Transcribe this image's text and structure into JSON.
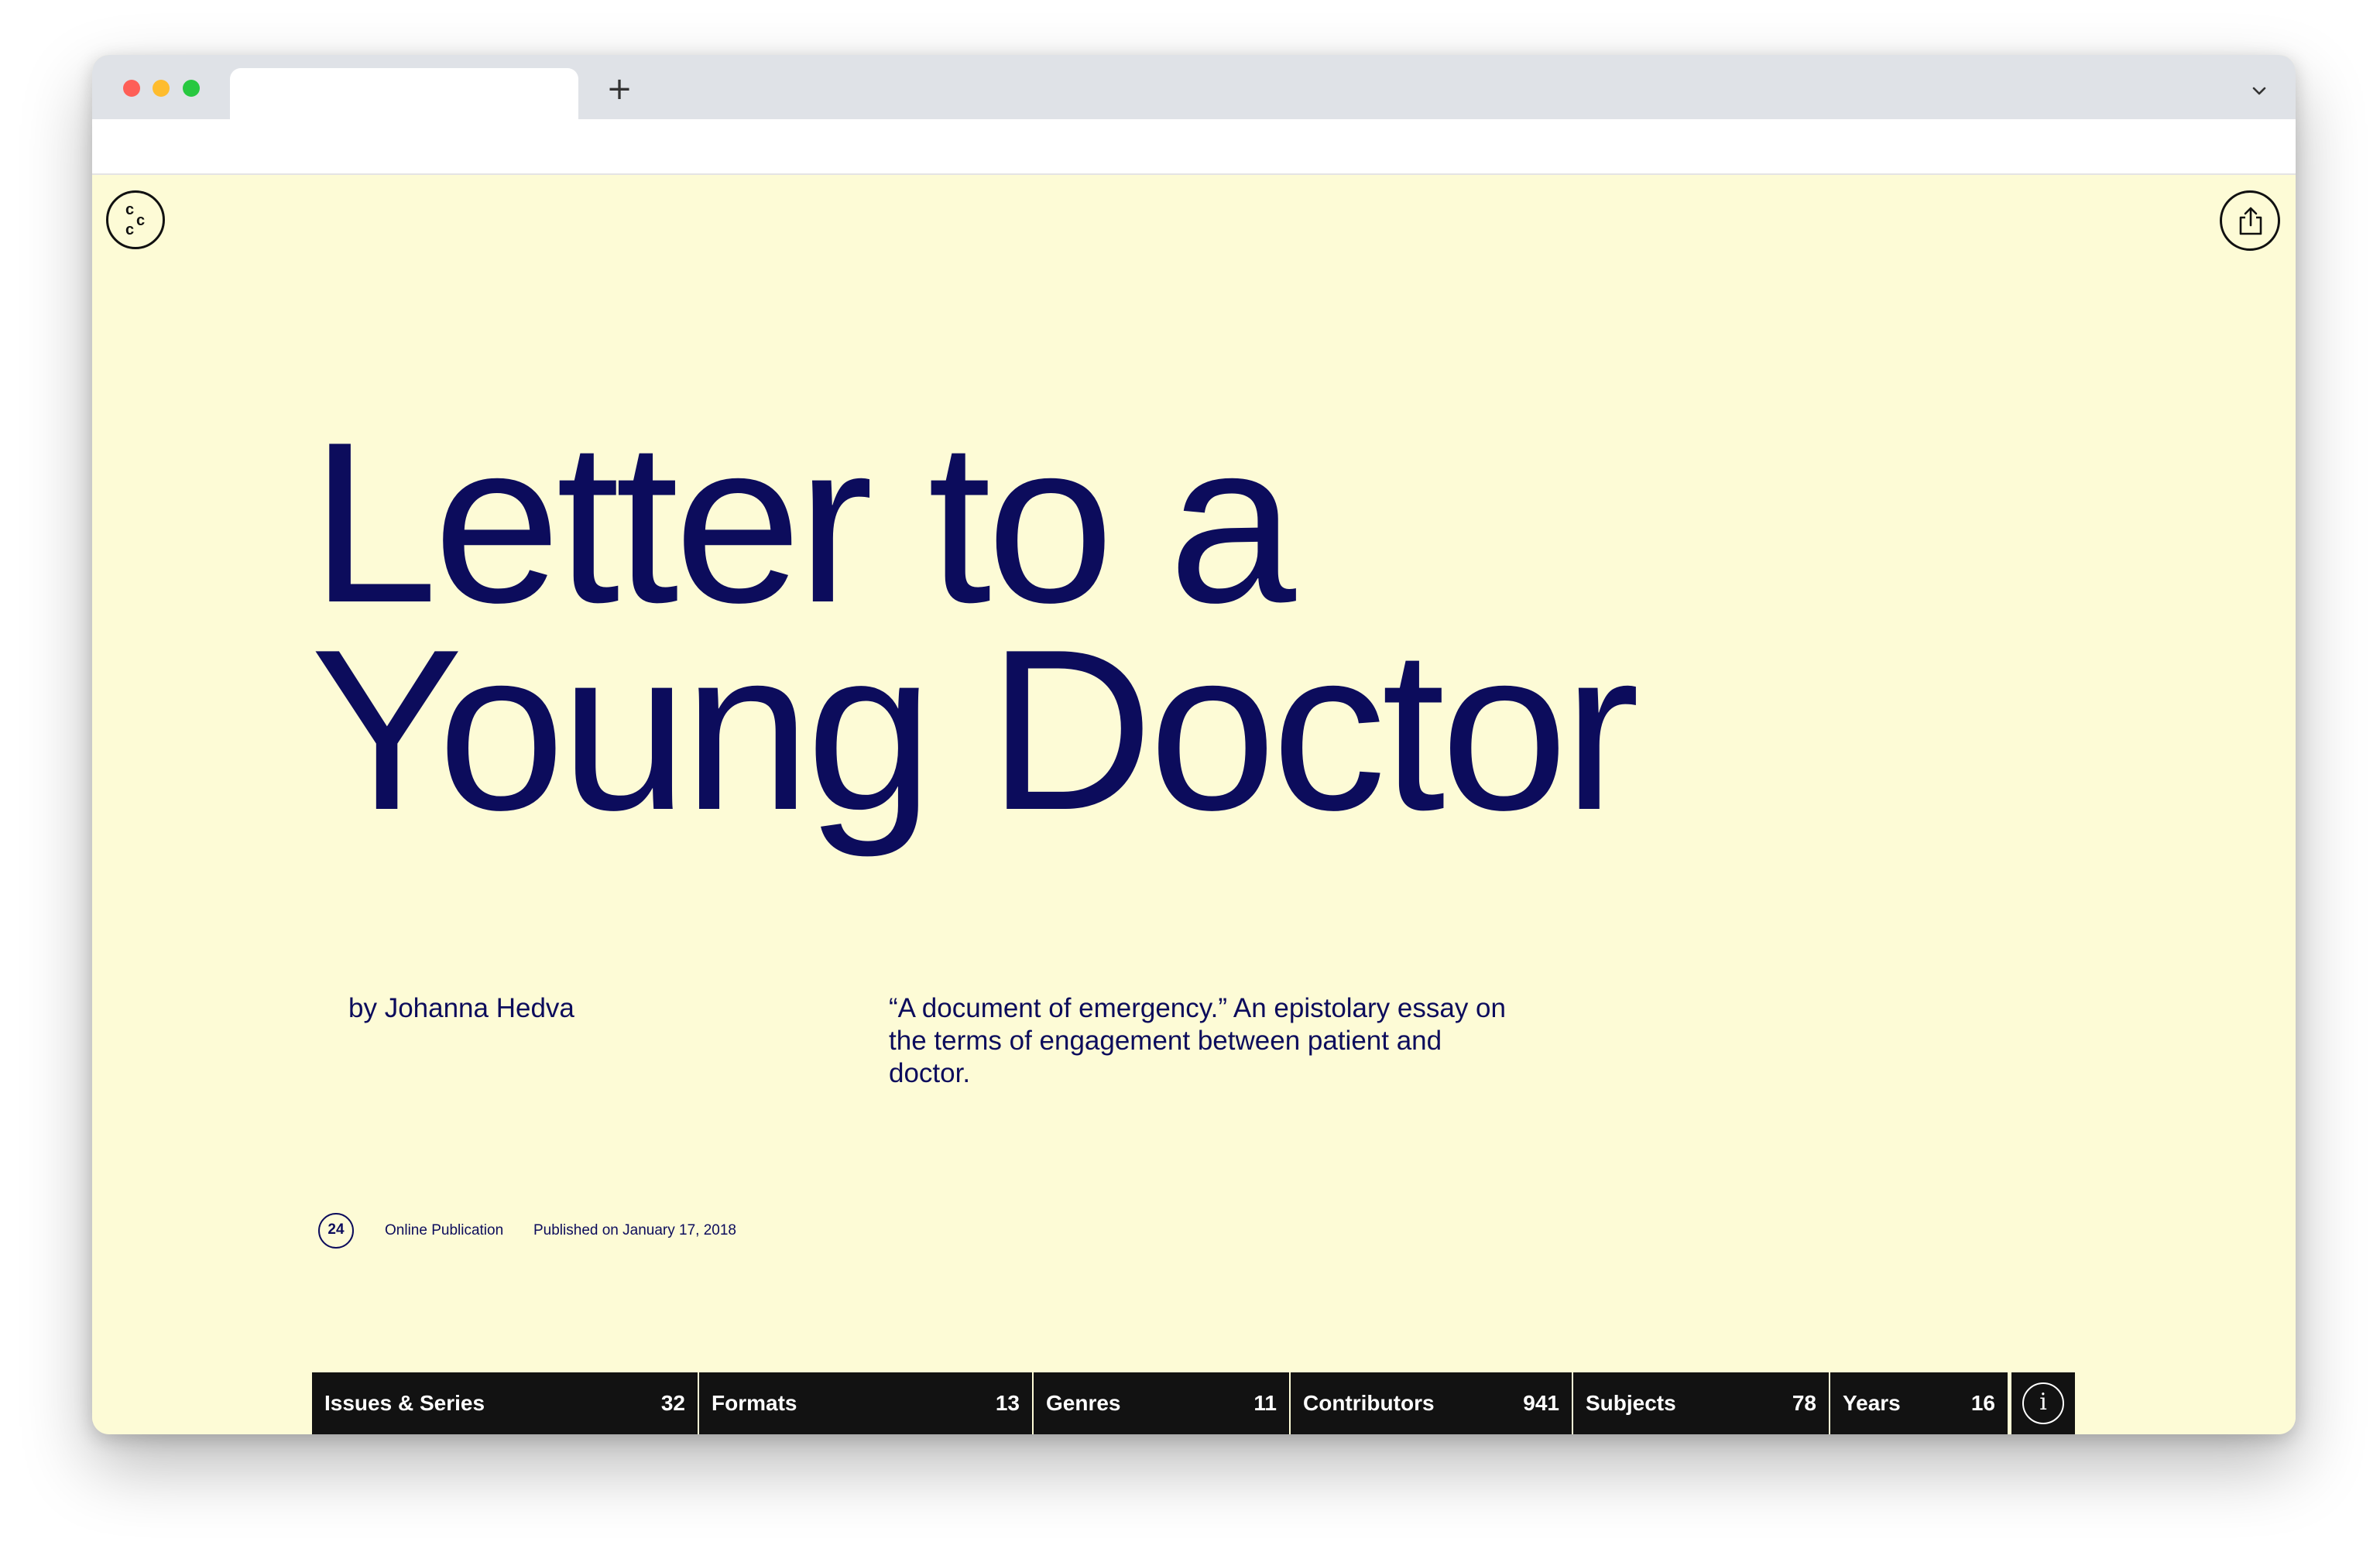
{
  "browser": {
    "new_tab_symbol": "+",
    "traffic_colors": {
      "close": "#fe5f57",
      "minimize": "#febc2e",
      "zoom": "#28c840"
    }
  },
  "site": {
    "logo_letters": [
      "c",
      "c",
      "c"
    ],
    "share_icon": "share-icon"
  },
  "article": {
    "title_line1": "Letter to a",
    "title_line2": "Young Doctor",
    "byline": "by Johanna Hedva",
    "blurb": "“A document of emergency.” An epistolary essay on the terms of engagement between patient and doctor.",
    "issue_number": "24",
    "publication_type": "Online Publication",
    "published": "Published on January 17, 2018"
  },
  "filters": [
    {
      "label": "Issues & Series",
      "count": "32"
    },
    {
      "label": "Formats",
      "count": "13"
    },
    {
      "label": "Genres",
      "count": "11"
    },
    {
      "label": "Contributors",
      "count": "941"
    },
    {
      "label": "Subjects",
      "count": "78"
    },
    {
      "label": "Years",
      "count": "16"
    }
  ],
  "info_button": {
    "symbol": "i"
  },
  "colors": {
    "page_background": "#fdfbd6",
    "text_navy": "#0c0c5c",
    "bar_black": "#121212"
  }
}
